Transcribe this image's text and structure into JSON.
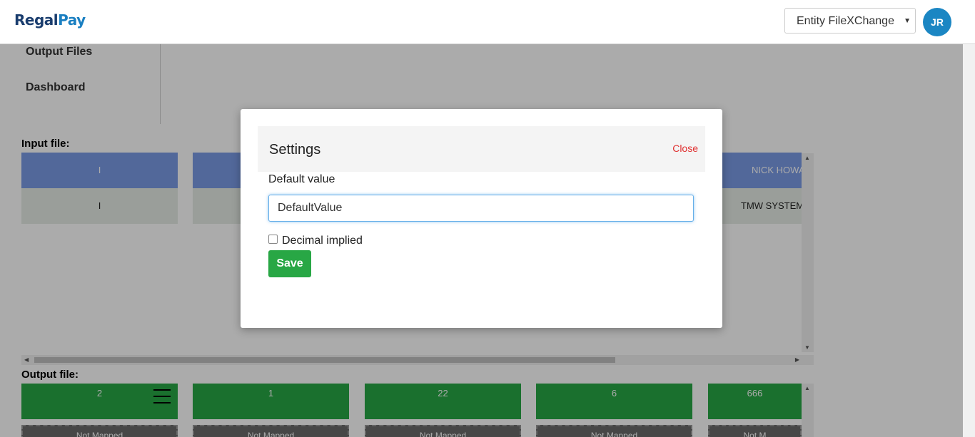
{
  "header": {
    "logo_part1": "Regal",
    "logo_part2": "Pay",
    "entity_select_value": "Entity FileXChange",
    "avatar_initials": "JR"
  },
  "nav": {
    "output_files": "Output Files",
    "dashboard": "Dashboard"
  },
  "input_file": {
    "label": "Input file:",
    "columns": [
      {
        "header": "I",
        "value": "I"
      },
      {
        "header": "",
        "value": ""
      },
      {
        "header": "NICK HOWA",
        "value": "TMW SYSTEM"
      }
    ]
  },
  "output_file": {
    "label": "Output file:",
    "columns": [
      {
        "header": "2",
        "sub": "Not Mapped"
      },
      {
        "header": "1",
        "sub": "Not Mapped"
      },
      {
        "header": "22",
        "sub": "Not Mapped"
      },
      {
        "header": "6",
        "sub": "Not Mapped"
      },
      {
        "header": "666",
        "sub": "Not M"
      }
    ]
  },
  "modal": {
    "title": "Settings",
    "close_label": "Close",
    "default_value_label": "Default value",
    "default_value": "DefaultValue",
    "decimal_implied_label": "Decimal implied",
    "decimal_implied_checked": false,
    "save_label": "Save"
  },
  "colors": {
    "brand_dark": "#1a3d6e",
    "brand_light": "#1a7fc1",
    "input_header": "#7b9be6",
    "output_header": "#28a745",
    "close_link": "#e03131",
    "save_button": "#28a745",
    "avatar": "#1b86c3"
  }
}
